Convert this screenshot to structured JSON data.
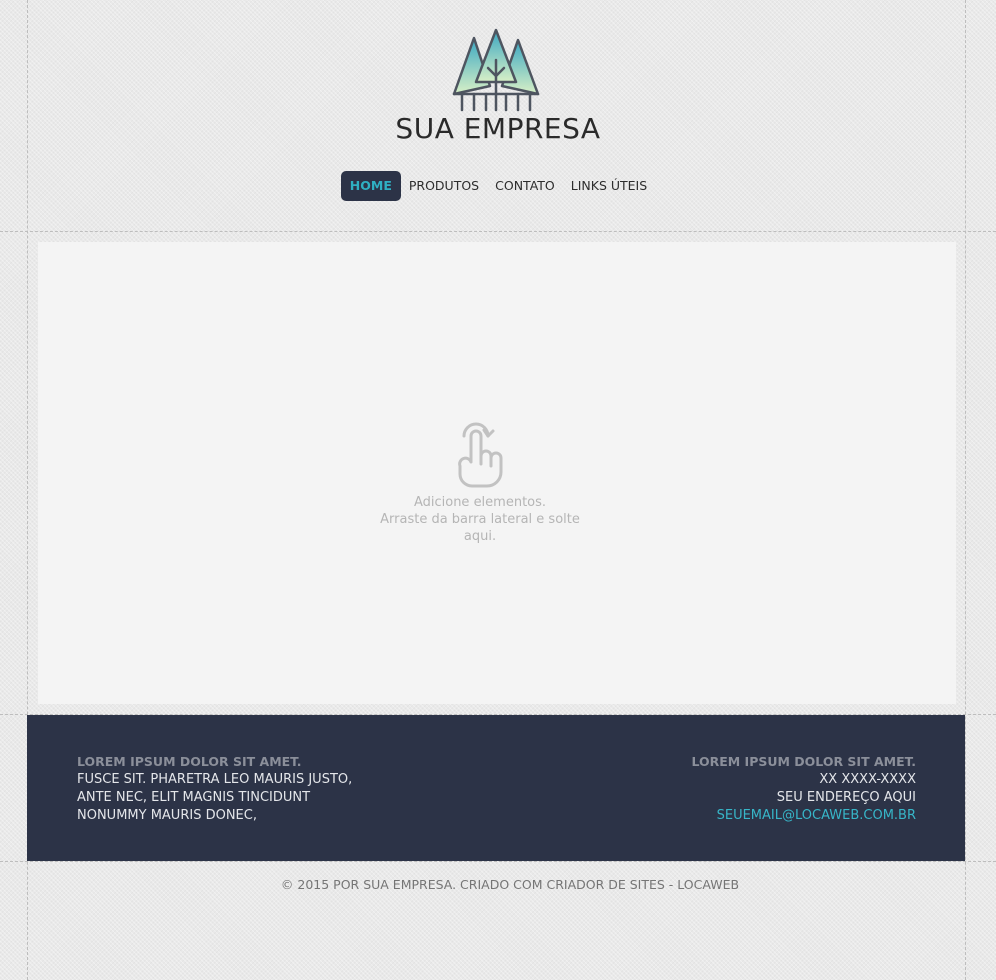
{
  "brand": {
    "name": "SUA EMPRESA",
    "logo": "pine-trees-logo"
  },
  "nav": {
    "items": [
      {
        "label": "HOME",
        "active": true
      },
      {
        "label": "PRODUTOS",
        "active": false
      },
      {
        "label": "CONTATO",
        "active": false
      },
      {
        "label": "LINKS ÚTEIS",
        "active": false
      }
    ]
  },
  "content": {
    "icon": "tap-hand-icon",
    "hint_line1": "Adicione elementos.",
    "hint_line2": "Arraste da barra lateral e solte aqui."
  },
  "footer": {
    "left": {
      "title": "LOREM IPSUM DOLOR SIT AMET.",
      "lines": [
        "FUSCE SIT. PHARETRA LEO MAURIS JUSTO,",
        "ANTE NEC, ELIT MAGNIS TINCIDUNT",
        "NONUMMY MAURIS DONEC,"
      ]
    },
    "right": {
      "title": "LOREM IPSUM DOLOR SIT AMET.",
      "phone": "XX XXXX-XXXX",
      "address": "SEU ENDEREÇO AQUI",
      "email": "SEUEMAIL@LOCAWEB.COM.BR"
    },
    "copyright": "© 2015 POR SUA EMPRESA. CRIADO COM CRIADOR DE SITES - LOCAWEB"
  },
  "colors": {
    "footer_bg": "#2c3347",
    "accent": "#37b6c8",
    "content_bg": "#f4f4f4",
    "page_bg": "#e9e9e9"
  }
}
